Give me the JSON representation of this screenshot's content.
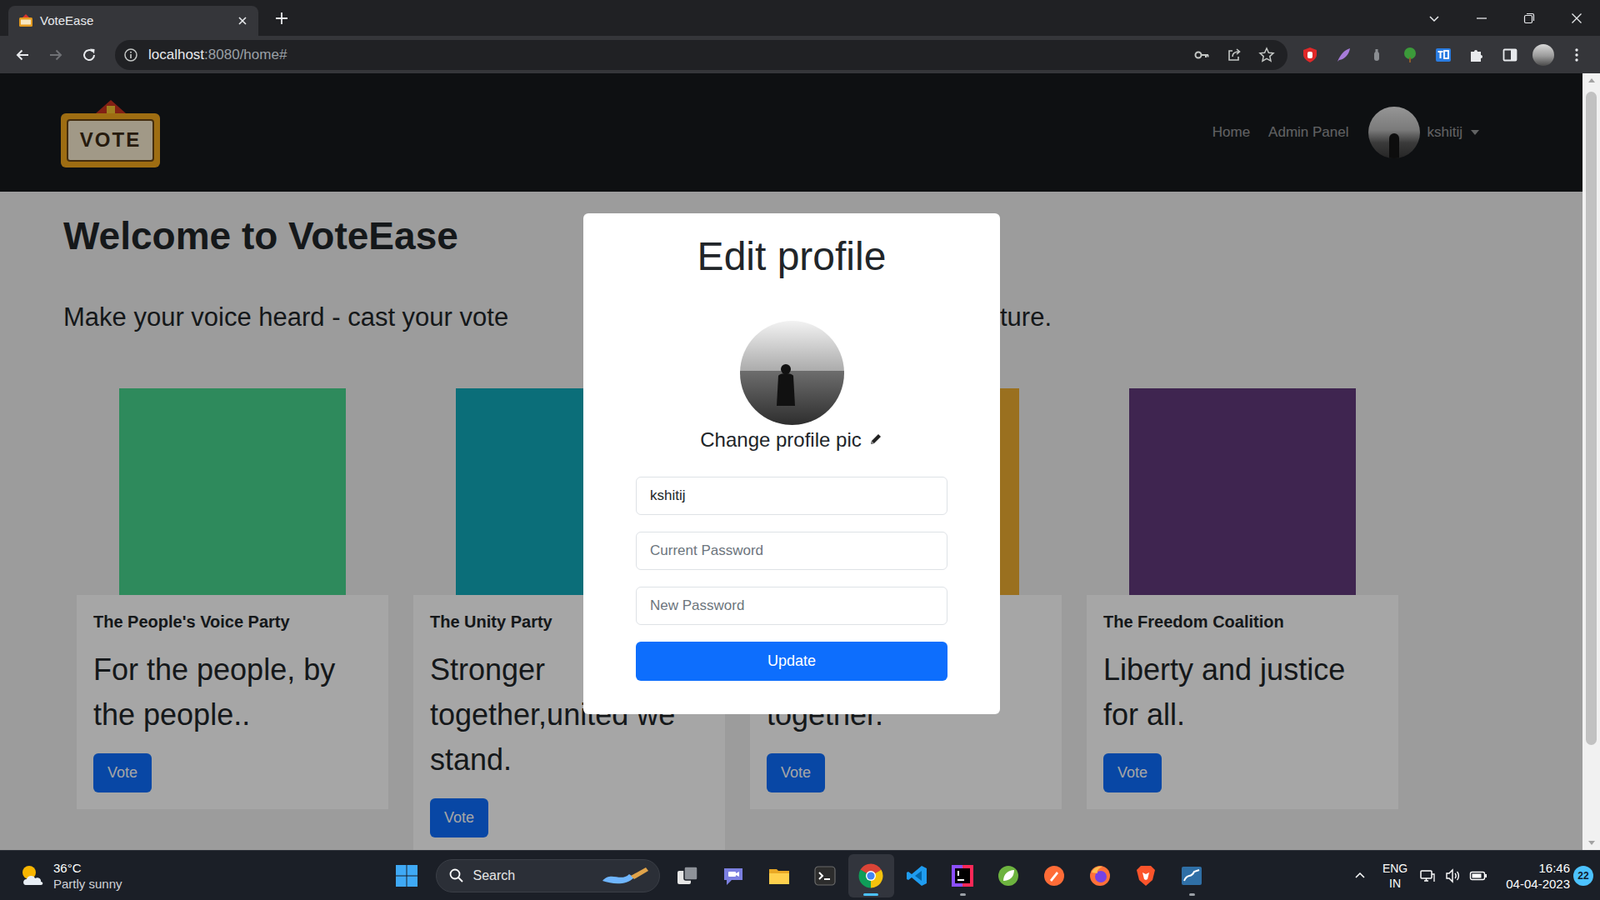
{
  "browser": {
    "tabs": [
      {
        "label": "VoteEase",
        "selected": true
      }
    ],
    "nav": {
      "forward_disabled": true
    },
    "address": {
      "host": "localhost",
      "rest": ":8080/home#"
    }
  },
  "navbar": {
    "logo_text": "VOTE",
    "links": [
      {
        "label": "Home"
      },
      {
        "label": "Admin Panel"
      }
    ],
    "user": "kshitij"
  },
  "hero": {
    "title": "Welcome to VoteEase",
    "subtitle_start": "Make your voice heard - cast your vote",
    "subtitle_end": "ture."
  },
  "parties": [
    {
      "name": "The People's Voice Party",
      "slogan": "For the people, by the people..",
      "button": "Vote",
      "color": "#48d48e"
    },
    {
      "name": "The Unity Party",
      "slogan": "Stronger together,united we stand.",
      "button": "Vote",
      "color": "#12aabb"
    },
    {
      "slogan": "together.",
      "button": "Vote",
      "color": "#edac31"
    },
    {
      "name": "The Freedom Coalition",
      "slogan": "Liberty and justice for all.",
      "button": "Vote",
      "color": "#61397b"
    }
  ],
  "modal": {
    "title": "Edit profile",
    "change_pic": "Change profile pic",
    "username": "kshitij",
    "current_password_placeholder": "Current Password",
    "new_password_placeholder": "New Password",
    "button": "Update"
  },
  "taskbar": {
    "weather": {
      "temp": "36°C",
      "condition": "Partly sunny"
    },
    "search": "Search",
    "apps": [
      {
        "running": false,
        "selected": false
      },
      {
        "running": false,
        "selected": false
      },
      {
        "running": false,
        "selected": false
      },
      {
        "running": false,
        "selected": false
      },
      {
        "running": true,
        "selected": true
      },
      {
        "running": false,
        "selected": false
      },
      {
        "running": true,
        "selected": false
      },
      {
        "running": false,
        "selected": false
      },
      {
        "running": false,
        "selected": false
      },
      {
        "running": false,
        "selected": false
      },
      {
        "running": false,
        "selected": false
      },
      {
        "running": true,
        "selected": false
      }
    ],
    "language": "ENG",
    "region": "IN",
    "time": "16:46",
    "date": "04-04-2023",
    "notifications": "22"
  }
}
